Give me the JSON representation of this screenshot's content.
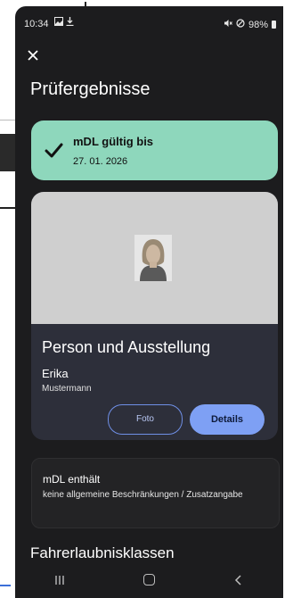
{
  "status": {
    "time": "10:34",
    "battery": "98%"
  },
  "header": {
    "close_icon": "close-icon",
    "title": "Prüfergebnisse"
  },
  "validity": {
    "title": "mDL gültig bis",
    "date": "27. 01. 2026",
    "icon": "check-icon",
    "color": "#8ed7bc"
  },
  "person_card": {
    "title": "Person und Ausstellung",
    "first_name": "Erika",
    "last_name": "Mustermann",
    "foto_label": "Foto",
    "details_label": "Details"
  },
  "restrictions": {
    "title": "mDL enthält",
    "text": "keine allgemeine Beschränkungen / Zusatzangabe"
  },
  "next_section": {
    "title": "Fahrerlaubnisklassen"
  },
  "navbar": {
    "recent_icon": "recent-apps-icon",
    "home_icon": "home-icon",
    "back_icon": "back-icon"
  },
  "colors": {
    "background": "#1c1c1e",
    "accent": "#7ea0f4",
    "card": "#2d2f3a"
  }
}
